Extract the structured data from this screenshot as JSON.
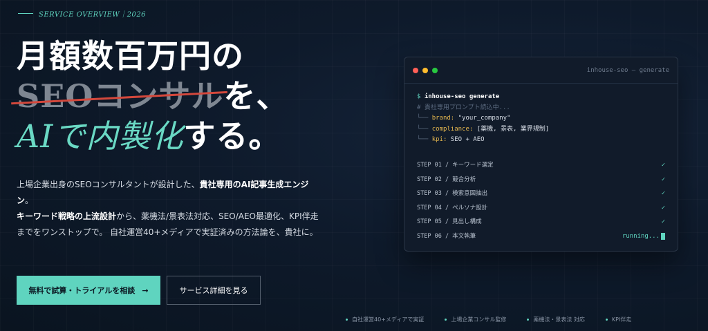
{
  "eyebrow": "SERVICE OVERVIEW｜2026",
  "headline": {
    "line1": "月額数百万円の",
    "struck": "SEOコンサル",
    "line2_rest": "を、",
    "accent": "AIで内製化",
    "line3_rest": "する。"
  },
  "description": {
    "p1_a": "上場企業出身のSEOコンサルタントが設計した、",
    "p1_b": "貴社専用のAI記事生成エンジン",
    "p1_c": "。",
    "p2_a": "キーワード戦略の上流設計",
    "p2_b": "から、薬機法/景表法対応、SEO/AEO最適化、KPI伴走までをワンストップで。 自社運営40+メディアで実証済みの方法論を、貴社に。"
  },
  "buttons": {
    "primary": "無料で試算・トライアルを相談",
    "primary_arrow": "→",
    "secondary": "サービス詳細を見る"
  },
  "terminal": {
    "title": "inhouse-seo — generate",
    "prompt": "$",
    "command": "inhouse-seo generate",
    "comment": "# 貴社専用プロンプト読込中...",
    "config": [
      {
        "tree": "└──",
        "key": "brand:",
        "value": "\"your_company\""
      },
      {
        "tree": "└──",
        "key": "compliance:",
        "value": "[薬機, 景表, 業界規制]"
      },
      {
        "tree": "└──",
        "key": "kpi:",
        "value": "SEO + AEO"
      }
    ],
    "steps": [
      {
        "label": "STEP 01 / キーワード選定",
        "status": "✓"
      },
      {
        "label": "STEP 02 / 競合分析",
        "status": "✓"
      },
      {
        "label": "STEP 03 / 検索意図抽出",
        "status": "✓"
      },
      {
        "label": "STEP 04 / ペルソナ設計",
        "status": "✓"
      },
      {
        "label": "STEP 05 / 見出し構成",
        "status": "✓"
      },
      {
        "label": "STEP 06 / 本文執筆",
        "status": "running..."
      }
    ]
  },
  "footer_tags": [
    "自社運営40+メディアで実証",
    "上場企業コンサル監修",
    "薬機法・景表法 対応",
    "KPI伴走"
  ],
  "colors": {
    "accent": "#5fd4bf",
    "strike": "#d4483c",
    "background": "#0e1a2b",
    "dot_red": "#ff5f57",
    "dot_yellow": "#febc2e",
    "dot_green": "#28c840"
  }
}
